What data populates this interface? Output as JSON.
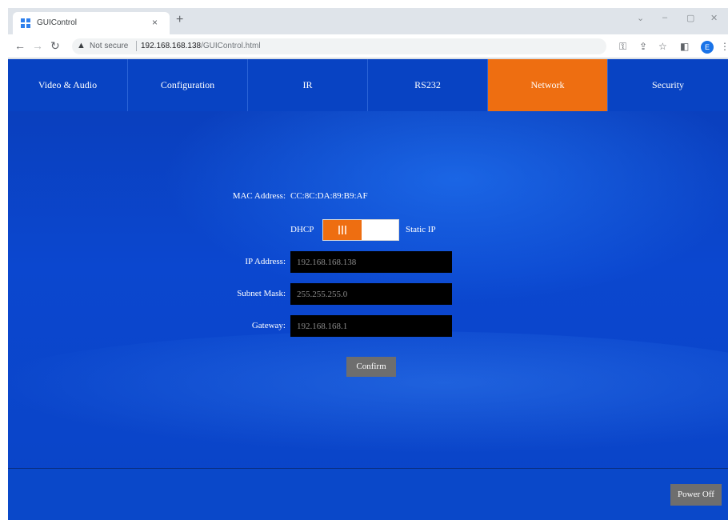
{
  "browser": {
    "tab_title": "GUIControl",
    "tab_close": "×",
    "new_tab": "+",
    "not_secure": "Not secure",
    "url_host": "192.168.168.138",
    "url_path": "/GUIControl.html",
    "profile_initial": "E",
    "window_controls": {
      "chevron": "⌄",
      "minimize": "–",
      "maximize": "▢",
      "close": "✕"
    },
    "icons": [
      "back-icon",
      "forward-icon",
      "reload-icon",
      "warning-icon",
      "key-icon",
      "share-icon",
      "star-icon",
      "sidebar-icon",
      "menu-icon"
    ]
  },
  "menu": {
    "items": [
      {
        "label": "Video & Audio"
      },
      {
        "label": "Configuration"
      },
      {
        "label": "IR"
      },
      {
        "label": "RS232"
      },
      {
        "label": "Network"
      },
      {
        "label": "Security"
      }
    ],
    "active": "Network",
    "active_color": "#ee6e11"
  },
  "network": {
    "mac_label": "MAC Address:",
    "mac_value": "CC:8C:DA:89:B9:AF",
    "mode_left": "DHCP",
    "mode_right": "Static IP",
    "mode_selected": "DHCP",
    "ip_label": "IP Address:",
    "ip_value": "192.168.168.138",
    "subnet_label": "Subnet Mask:",
    "subnet_value": "255.255.255.0",
    "gateway_label": "Gateway:",
    "gateway_value": "192.168.168.1",
    "confirm_label": "Confirm"
  },
  "footer": {
    "power_label": "Power Off"
  },
  "colors": {
    "page_bg": "#0b47cf",
    "accent": "#ee6e11",
    "button_gray": "#6e6e6e"
  }
}
